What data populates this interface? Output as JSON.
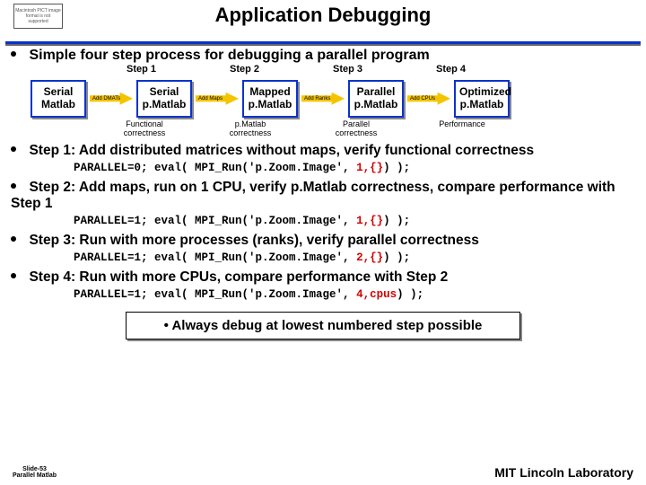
{
  "header": {
    "title": "Application Debugging",
    "img_err": "Macintosh PICT image format is not supported"
  },
  "lead": "Simple four step process for debugging a parallel program",
  "flow": {
    "steps": [
      "Step 1",
      "Step 2",
      "Step 3",
      "Step 4"
    ],
    "boxes": [
      "Serial\nMatlab",
      "Serial\np.Matlab",
      "Mapped\np.Matlab",
      "Parallel\np.Matlab",
      "Optimized\np.Matlab"
    ],
    "arrows": [
      "Add DMATs",
      "Add Maps",
      "Add Ranks",
      "Add CPUs"
    ],
    "corr": [
      "Functional\ncorrectness",
      "p.Matlab\ncorrectness",
      "Parallel\ncorrectness",
      "Performance"
    ]
  },
  "bullets": [
    {
      "text": "Step 1: Add distributed matrices without maps, verify functional correctness",
      "code_pre": "PARALLEL=0;    eval( MPI_Run('p.Zoom.Image',",
      "code_red": " 1,{}",
      "code_post": ") );"
    },
    {
      "text": "Step 2: Add maps, run on 1 CPU, verify p.Matlab correctness, compare performance with Step 1",
      "code_pre": "PARALLEL=1;    eval( MPI_Run('p.Zoom.Image',",
      "code_red": " 1,{}",
      "code_post": ") );"
    },
    {
      "text": "Step 3: Run with more processes (ranks), verify parallel correctness",
      "code_pre": "PARALLEL=1;    eval( MPI_Run('p.Zoom.Image',",
      "code_red": " 2,{}",
      "code_post": ") );"
    },
    {
      "text": "Step 4: Run with more CPUs, compare performance with Step 2",
      "code_pre": "PARALLEL=1;    eval( MPI_Run('p.Zoom.Image',",
      "code_red": " 4,cpus",
      "code_post": ") );"
    }
  ],
  "debug_box": "Always debug at lowest numbered step possible",
  "footer": {
    "left_line1": "Slide-53",
    "left_line2": "Parallel Matlab",
    "right": "MIT Lincoln Laboratory"
  }
}
